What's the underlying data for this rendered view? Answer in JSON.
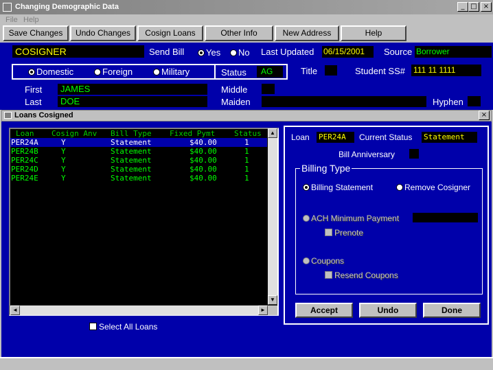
{
  "window": {
    "title": "Changing Demographic Data"
  },
  "window_buttons": {
    "minimize": "_",
    "maximize": "□",
    "close": "×"
  },
  "menu": {
    "file": "File",
    "help": "Help"
  },
  "toolbar": {
    "save": "Save Changes",
    "undo": "Undo Changes",
    "cosign": "Cosign Loans",
    "other": "Other Info",
    "new_address": "New Address",
    "help": "Help"
  },
  "header": {
    "role": "COSIGNER",
    "send_bill_label": "Send Bill",
    "yes": "Yes",
    "no": "No",
    "last_updated_label": "Last Updated",
    "last_updated": "06/15/2001",
    "source_label": "Source",
    "source": "Borrower",
    "domestic": "Domestic",
    "foreign": "Foreign",
    "military": "Military",
    "status_label": "Status",
    "status": "AG",
    "title_label": "Title",
    "student_ss_label": "Student SS#",
    "student_ss": "111 11 1111",
    "first_label": "First",
    "first": "JAMES",
    "middle_label": "Middle",
    "last_label": "Last",
    "last": "DOE",
    "maiden_label": "Maiden",
    "hyphen_label": "Hyphen"
  },
  "loans_window": {
    "title": "Loans Cosigned",
    "close": "×",
    "columns": [
      "Loan",
      "Cosign Anv",
      "Bill Type",
      "Fixed Pymt",
      "Status"
    ],
    "rows": [
      [
        "PER24A",
        "Y",
        "Statement",
        "$40.00",
        "1"
      ],
      [
        "PER24B",
        "Y",
        "Statement",
        "$40.00",
        "1"
      ],
      [
        "PER24C",
        "Y",
        "Statement",
        "$40.00",
        "1"
      ],
      [
        "PER24D",
        "Y",
        "Statement",
        "$40.00",
        "1"
      ],
      [
        "PER24E",
        "Y",
        "Statement",
        "$40.00",
        "1"
      ]
    ],
    "select_all": "Select All Loans",
    "scroll_up": "▲",
    "scroll_down": "▼",
    "scroll_left": "◄",
    "scroll_right": "►",
    "detail": {
      "loan_label": "Loan",
      "loan": "PER24A",
      "current_status_label": "Current Status",
      "current_status": "Statement",
      "bill_anniversary_label": "Bill Anniversary",
      "billing_type_label": "Billing Type",
      "billing_statement": "Billing Statement",
      "remove_cosigner": "Remove Cosigner",
      "ach_min": "ACH Minimum Payment",
      "prenote": "Prenote",
      "coupons": "Coupons",
      "resend_coupons": "Resend Coupons",
      "accept": "Accept",
      "undo": "Undo",
      "done": "Done"
    }
  }
}
